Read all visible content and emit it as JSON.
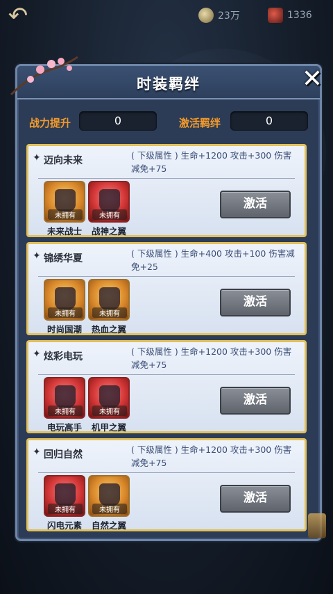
{
  "topbar": {
    "back_icon": "back-arrow-icon",
    "resources": [
      {
        "icon": "coin-icon",
        "value": "23万"
      },
      {
        "icon": "gem-icon",
        "value": "1336"
      }
    ]
  },
  "panel": {
    "title": "时装羁绊",
    "close_icon": "close-icon"
  },
  "stats": {
    "power_label": "战力提升",
    "power_value": "0",
    "bond_label": "激活羁绊",
    "bond_value": "0"
  },
  "cards": [
    {
      "name": "迈向未来",
      "desc": "( 下级属性 ) 生命+1200 攻击+300 伤害减免+75",
      "items": [
        {
          "name": "未来战士",
          "badge": "未拥有",
          "icon": "armor-icon"
        },
        {
          "name": "战神之翼",
          "badge": "未拥有",
          "icon": "wings-icon"
        }
      ],
      "button": "激活"
    },
    {
      "name": "锦绣华夏",
      "desc": "( 下级属性 ) 生命+400 攻击+100 伤害减免+25",
      "items": [
        {
          "name": "时尚国潮",
          "badge": "未拥有",
          "icon": "armor-icon"
        },
        {
          "name": "热血之翼",
          "badge": "未拥有",
          "icon": "wings-icon"
        }
      ],
      "button": "激活"
    },
    {
      "name": "炫彩电玩",
      "desc": "( 下级属性 ) 生命+1200 攻击+300 伤害减免+75",
      "items": [
        {
          "name": "电玩高手",
          "badge": "未拥有",
          "icon": "armor-icon"
        },
        {
          "name": "机甲之翼",
          "badge": "未拥有",
          "icon": "wings-icon"
        }
      ],
      "button": "激活"
    },
    {
      "name": "回归自然",
      "desc": "( 下级属性 ) 生命+1200 攻击+300 伤害减免+75",
      "items": [
        {
          "name": "闪电元素",
          "badge": "未拥有",
          "icon": "armor-icon"
        },
        {
          "name": "自然之翼",
          "badge": "未拥有",
          "icon": "wings-icon"
        }
      ],
      "button": "激活"
    }
  ]
}
